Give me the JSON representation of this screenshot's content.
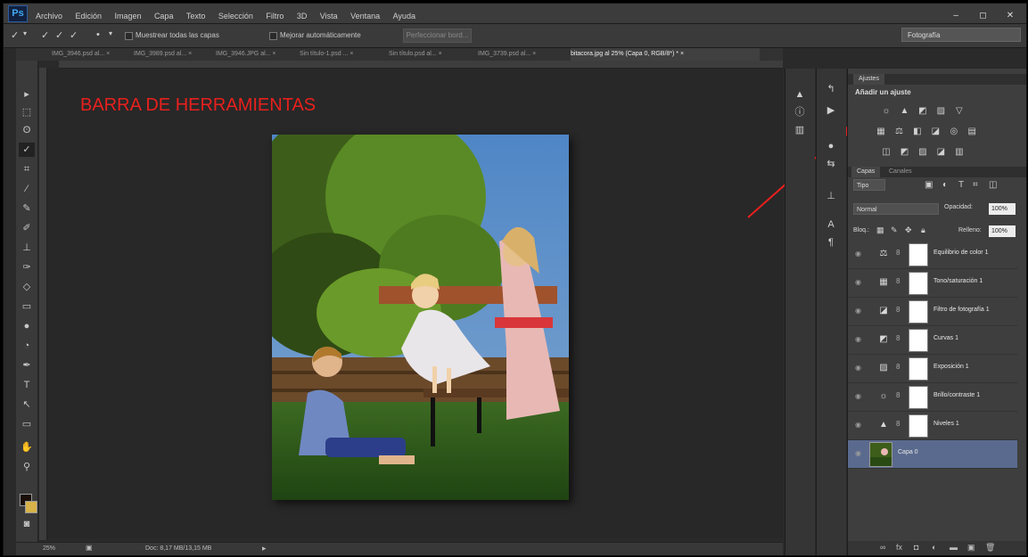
{
  "app": {
    "logo": "Ps",
    "menus": [
      "Archivo",
      "Edición",
      "Imagen",
      "Capa",
      "Texto",
      "Selección",
      "Filtro",
      "3D",
      "Vista",
      "Ventana",
      "Ayuda"
    ],
    "window_buttons": [
      "–",
      "◻",
      "✕"
    ]
  },
  "options_bar": {
    "sample_all_layers": "Muestrear todas las capas",
    "auto_enhance": "Mejorar automáticamente",
    "refine_edge": "Perfeccionar bord...",
    "workspace": "Fotografía"
  },
  "tabs": [
    {
      "label": "IMG_3946.psd al... ×"
    },
    {
      "label": "IMG_3989.psd al... ×"
    },
    {
      "label": "IMG_3946.JPG al... ×"
    },
    {
      "label": "Sin título-1.psd ... ×"
    },
    {
      "label": "Sin título.psd al... ×"
    },
    {
      "label": "IMG_3739.psd al... ×"
    },
    {
      "label": "bitacora.jpg al 25% (Capa 0, RGB/8*) * ×"
    }
  ],
  "annotation": {
    "title": "BARRA DE HERRAMIENTAS",
    "color": "#e8201d"
  },
  "status_bar": {
    "zoom": "25%",
    "doc_size": "Doc: 8,17 MB/13,15 MB"
  },
  "adjustments": {
    "tab": "Ajustes",
    "title": "Añadir un ajuste",
    "rows": [
      [
        "☼",
        "▲",
        "◩",
        "▨",
        "▽"
      ],
      [
        "▦",
        "⚖",
        "◧",
        "◪",
        "◎",
        "▤"
      ],
      [
        "◫",
        "◩",
        "▨",
        "◪",
        "▥"
      ]
    ]
  },
  "layers_panel": {
    "tabs": [
      "Capas",
      "Canales"
    ],
    "filter_kind": "Tipo",
    "blend_mode": "Normal",
    "opacity_label": "Opacidad:",
    "opacity_value": "100%",
    "lock_label": "Bloq.:",
    "fill_label": "Relleno:",
    "fill_value": "100%",
    "layers": [
      {
        "name": "Equilibrio de color 1",
        "icon": "⚖"
      },
      {
        "name": "Tono/saturación 1",
        "icon": "▦"
      },
      {
        "name": "Filtro de fotografía 1",
        "icon": "◪"
      },
      {
        "name": "Curvas 1",
        "icon": "◩"
      },
      {
        "name": "Exposición 1",
        "icon": "▨"
      },
      {
        "name": "Brillo/contraste 1",
        "icon": "☼"
      },
      {
        "name": "Niveles 1",
        "icon": "▲"
      },
      {
        "name": "Capa 0",
        "icon": ""
      }
    ]
  },
  "colors": {
    "selected_layer": "#5a6a8e",
    "foreground": "#1a0f08",
    "background": "#d8b24a",
    "arrow": "#e8201d"
  }
}
